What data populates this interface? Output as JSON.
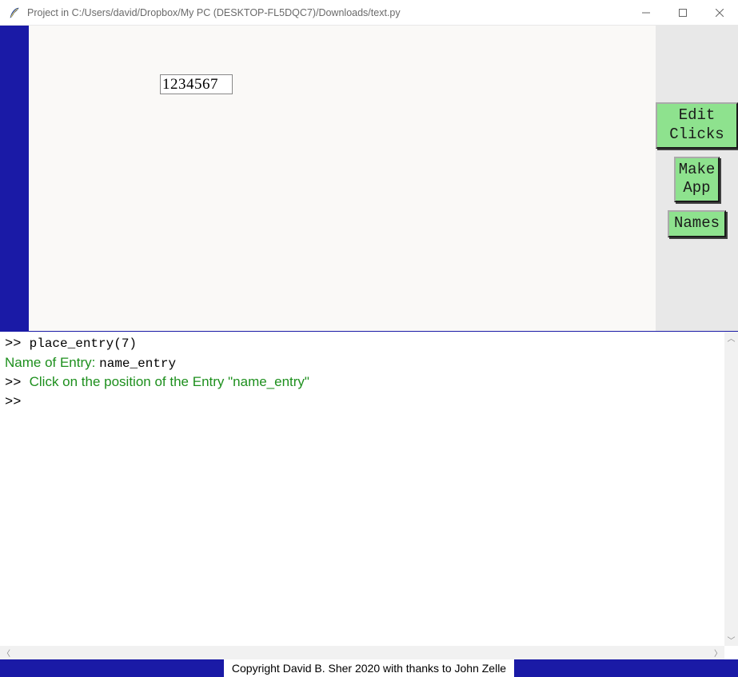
{
  "window": {
    "title": "Project in C:/Users/david/Dropbox/My PC (DESKTOP-FL5DQC7)/Downloads/text.py"
  },
  "canvas": {
    "entry_value": "1234567"
  },
  "sidebar": {
    "buttons": [
      {
        "id": "edit-clicks",
        "label": "Edit\nClicks"
      },
      {
        "id": "make-app",
        "label": "Make\nApp"
      },
      {
        "id": "names",
        "label": "Names"
      }
    ]
  },
  "console": {
    "lines": [
      {
        "prompt": ">> ",
        "kind": "mono",
        "text": "place_entry(7)"
      },
      {
        "prompt": "",
        "kind": "labelval",
        "label": "Name of Entry: ",
        "value": "name_entry"
      },
      {
        "prompt": ">>  ",
        "kind": "green",
        "text": "Click on the position of the Entry \"name_entry\""
      },
      {
        "prompt": ">>  ",
        "kind": "empty",
        "text": ""
      }
    ]
  },
  "footer": {
    "copyright": "Copyright David B. Sher 2020 with thanks to John Zelle"
  }
}
